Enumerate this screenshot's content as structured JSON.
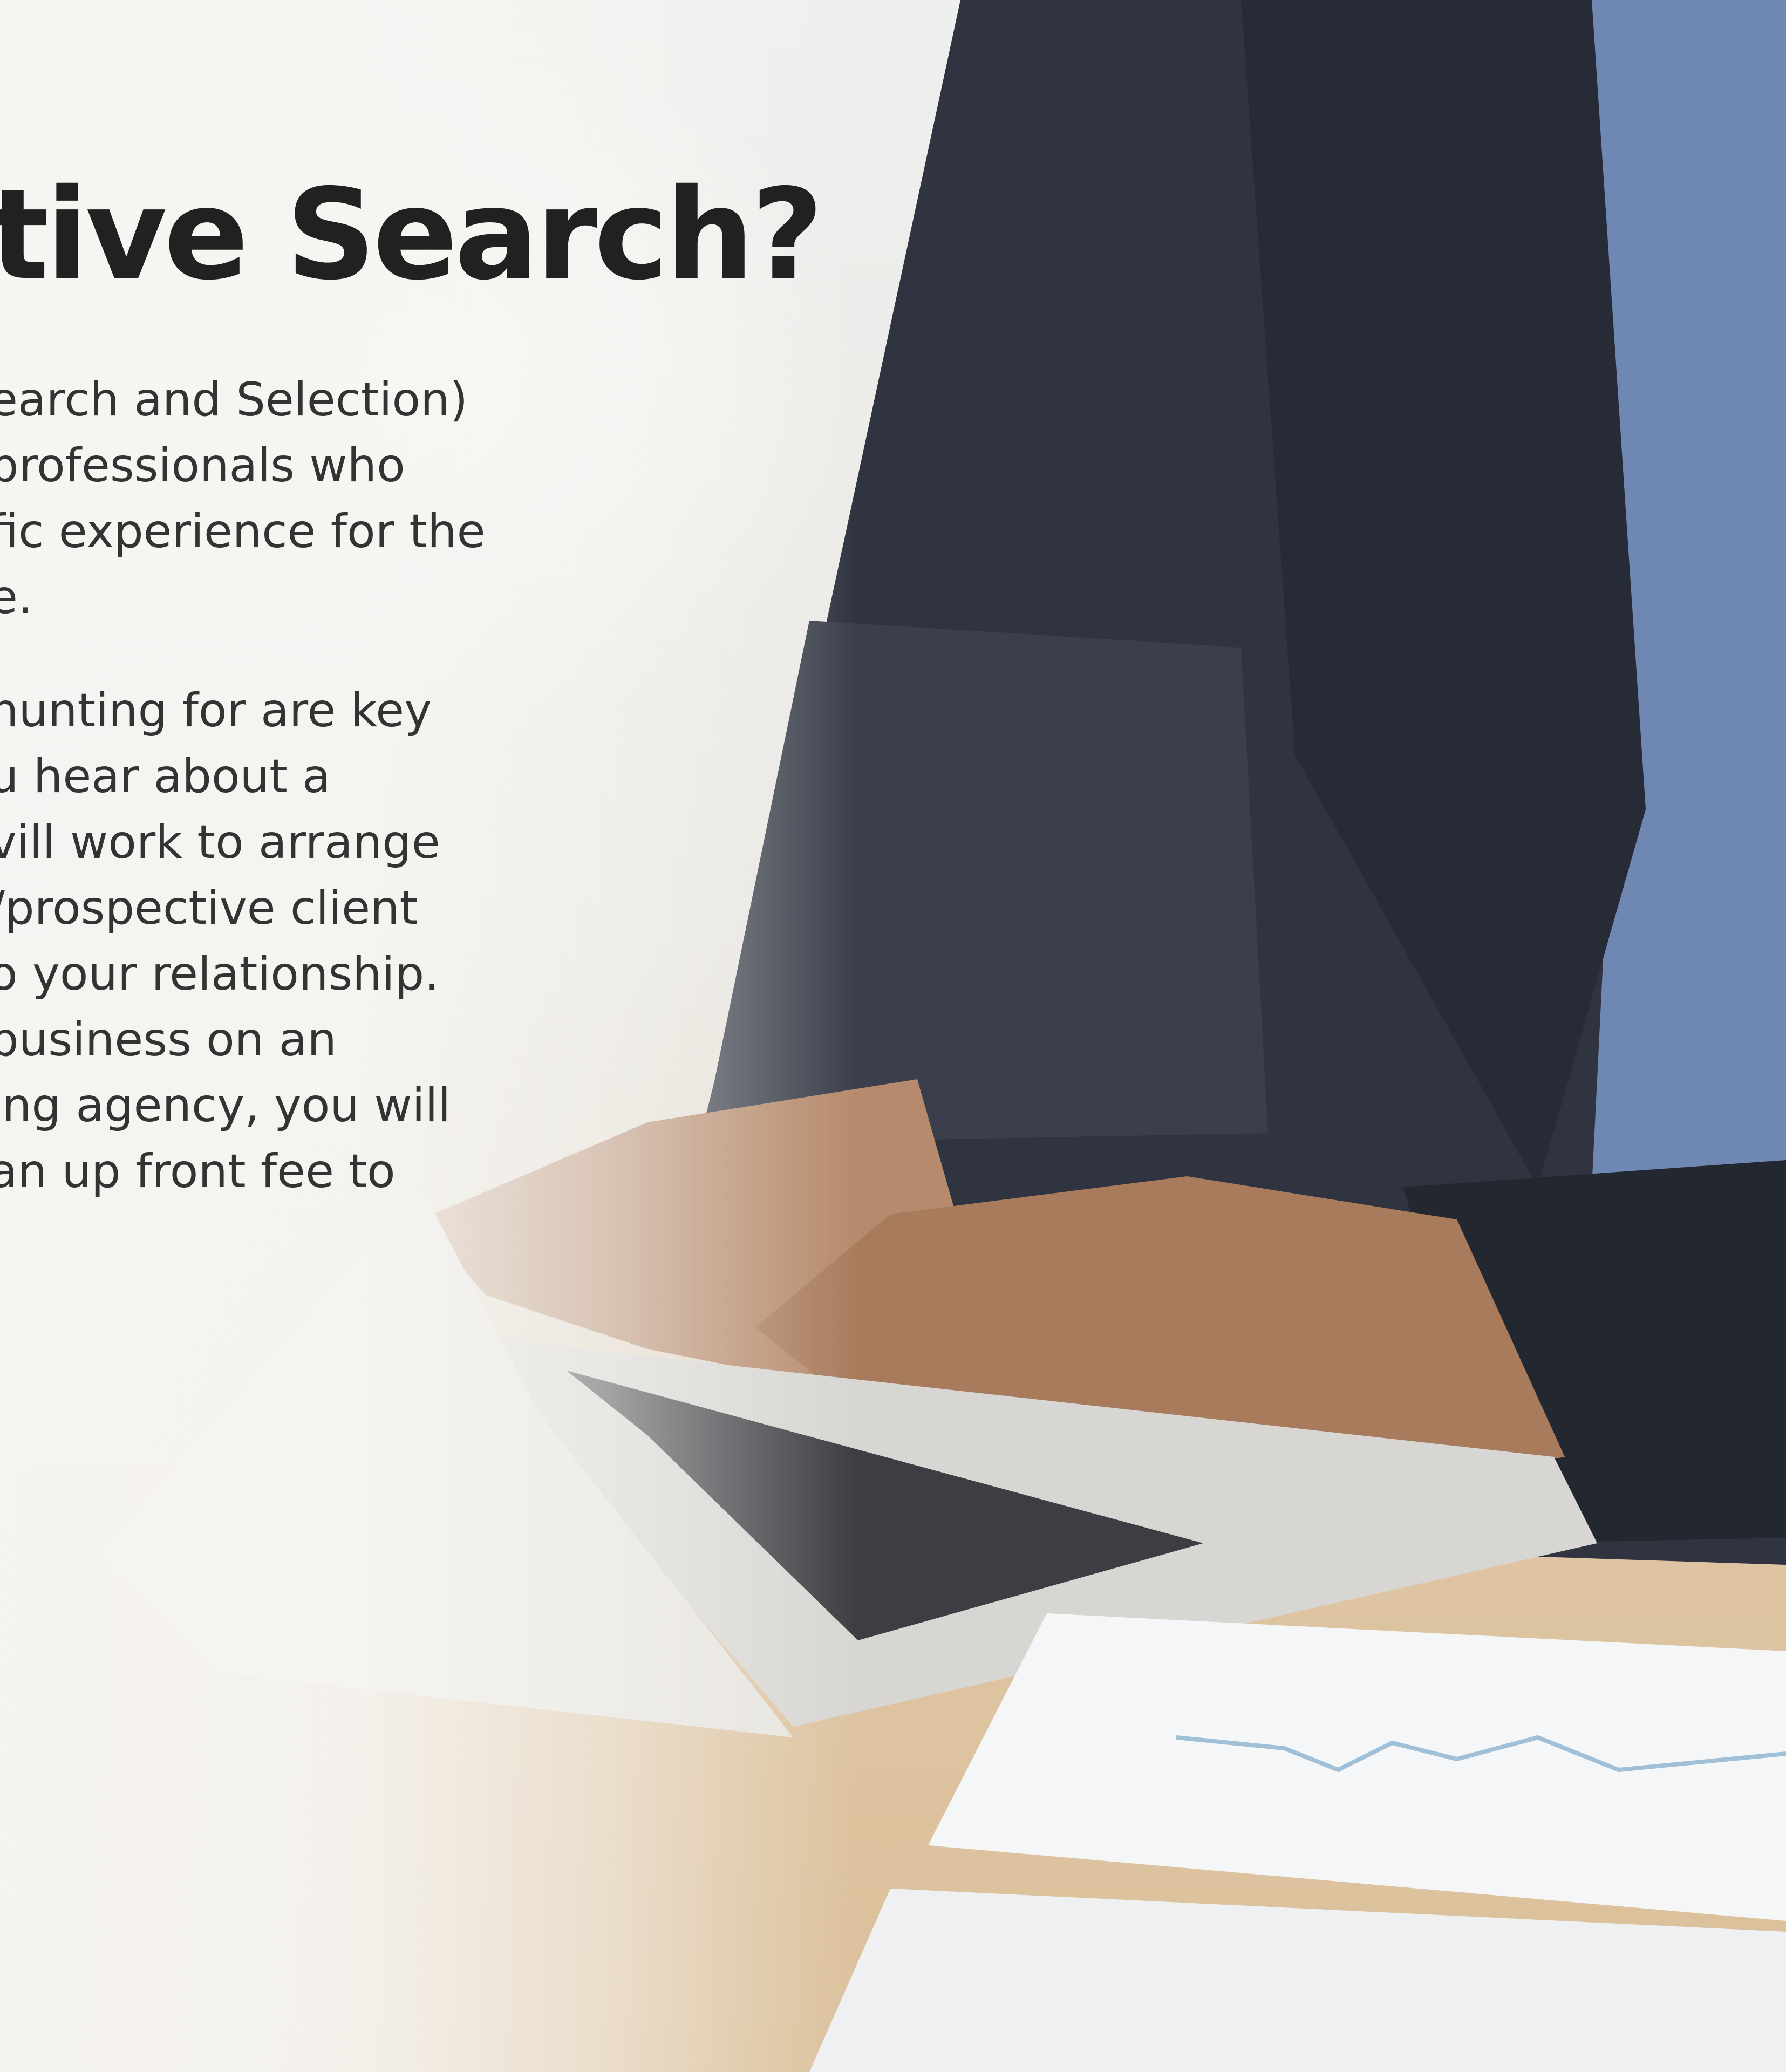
{
  "headline": "tive Search?",
  "paragraph_1_lines": [
    "earch and Selection)",
    "professionals who",
    "fic experience for the",
    "e."
  ],
  "paragraph_2_lines": [
    "hunting for are key",
    "u hear about a",
    "vill work to arrange",
    "/prospective client",
    "o your relationship.",
    "business on an",
    "ing agency, you will",
    "an up front fee to"
  ],
  "colors": {
    "headline": "#212121",
    "body_text": "#333333",
    "suit": "#2f3440",
    "shirt": "#6e88b3",
    "laptop": "#d8d6d2",
    "desk": "#d9b88d"
  }
}
